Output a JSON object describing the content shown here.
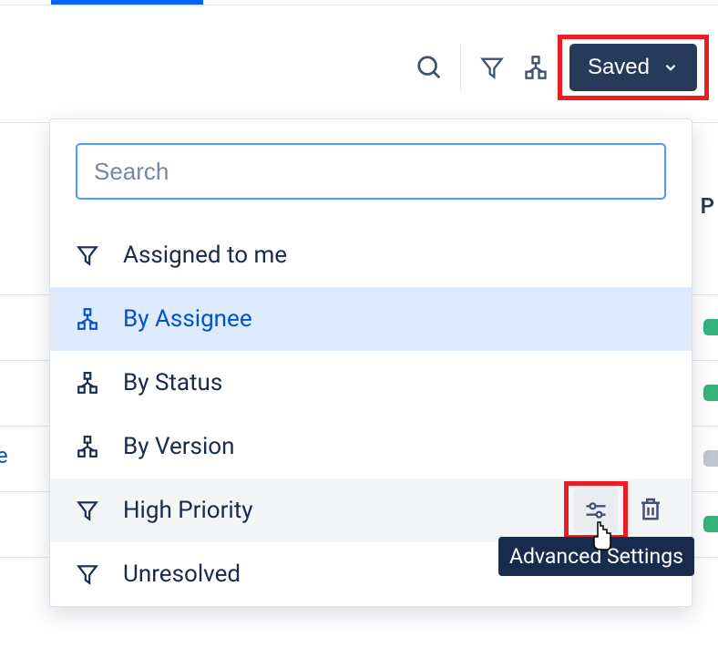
{
  "toolbar": {
    "saved_button_label": "Saved"
  },
  "search": {
    "placeholder": "Search",
    "value": ""
  },
  "filters": [
    {
      "icon": "filter",
      "label": "Assigned to me",
      "state": "default"
    },
    {
      "icon": "diagram",
      "label": "By Assignee",
      "state": "selected"
    },
    {
      "icon": "diagram",
      "label": "By Status",
      "state": "default"
    },
    {
      "icon": "diagram",
      "label": "By Version",
      "state": "default"
    },
    {
      "icon": "filter",
      "label": "High Priority",
      "state": "hovered"
    },
    {
      "icon": "filter",
      "label": "Unresolved",
      "state": "default"
    }
  ],
  "tooltip": {
    "advanced_settings": "Advanced Settings"
  },
  "background": {
    "priority_col_letter": "P",
    "partial_link_text": "le",
    "pill_colors": {
      "green": "#36b37e",
      "gray": "#c1c7d0"
    }
  },
  "highlights": {
    "saved_button": true,
    "settings_button": true
  }
}
